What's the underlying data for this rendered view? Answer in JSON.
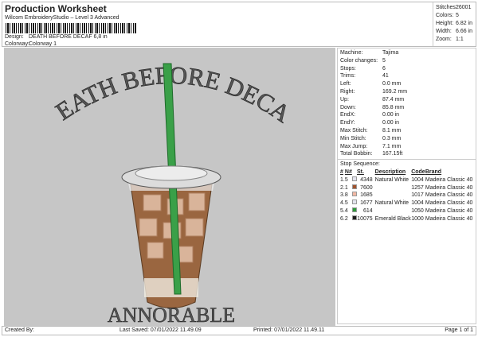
{
  "header": {
    "title": "Production Worksheet",
    "subtitle": "Wilcom EmbroideryStudio – Level 3 Advanced",
    "design_label": "Design:",
    "design_value": "DEATH BEFORE DECAF 6,8 in",
    "colorway_label": "Colorway:",
    "colorway_value": "Colorway 1"
  },
  "stats": [
    {
      "k": "Stitches:",
      "v": "26001"
    },
    {
      "k": "Colors:",
      "v": "5"
    },
    {
      "k": "Height:",
      "v": "6.82 in"
    },
    {
      "k": "Width:",
      "v": "6.66 in"
    },
    {
      "k": "Zoom:",
      "v": "1:1"
    }
  ],
  "design": {
    "top_text": "DEATH BEFORE DECAF",
    "bottom_text": "ANNORABLE"
  },
  "info": [
    {
      "k": "Machine:",
      "v": "Tajima"
    },
    {
      "k": "Color changes:",
      "v": "5"
    },
    {
      "k": "Stops:",
      "v": "6"
    },
    {
      "k": "Trims:",
      "v": "41"
    },
    {
      "k": "Left:",
      "v": "0.0 mm"
    },
    {
      "k": "Right:",
      "v": "169.2 mm"
    },
    {
      "k": "Up:",
      "v": "87.4 mm"
    },
    {
      "k": "Down:",
      "v": "85.8 mm"
    },
    {
      "k": "EndX:",
      "v": "0.00 in"
    },
    {
      "k": "EndY:",
      "v": "0.00 in"
    },
    {
      "k": "Max Stitch:",
      "v": "8.1 mm"
    },
    {
      "k": "Min Stitch:",
      "v": "0.3 mm"
    },
    {
      "k": "Max Jump:",
      "v": "7.1 mm"
    },
    {
      "k": "Total Bobbin:",
      "v": "167.15ft"
    }
  ],
  "stop_sequence": {
    "title": "Stop Sequence:",
    "headers": [
      "#",
      "N#",
      "",
      "St.",
      "Description",
      "Code",
      "Brand"
    ],
    "rows": [
      {
        "i": "1.",
        "n": "5",
        "color": "#e4e4ee",
        "st": "4348",
        "desc": "Natural White",
        "code": "1004",
        "brand": "Madeira Classic 40"
      },
      {
        "i": "2.",
        "n": "1",
        "color": "#a0522d",
        "st": "7600",
        "desc": "",
        "code": "1257",
        "brand": "Madeira Classic 40"
      },
      {
        "i": "3.",
        "n": "8",
        "color": "#f2b8a4",
        "st": "1685",
        "desc": "",
        "code": "1017",
        "brand": "Madeira Classic 40"
      },
      {
        "i": "4.",
        "n": "5",
        "color": "#e4e4ee",
        "st": "1677",
        "desc": "Natural White",
        "code": "1004",
        "brand": "Madeira Classic 40"
      },
      {
        "i": "5.",
        "n": "4",
        "color": "#2e9a3a",
        "st": "614",
        "desc": "",
        "code": "1050",
        "brand": "Madeira Classic 40"
      },
      {
        "i": "6.",
        "n": "2",
        "color": "#1e1e1e",
        "st": "10075",
        "desc": "Emerald Black",
        "code": "1000",
        "brand": "Madeira Classic 40"
      }
    ]
  },
  "footer": {
    "created": "Created By:",
    "saved": "Last Saved: 07/01/2022 11.49.09",
    "printed": "Printed: 07/01/2022 11.49.11",
    "page": "Page 1 of 1"
  }
}
